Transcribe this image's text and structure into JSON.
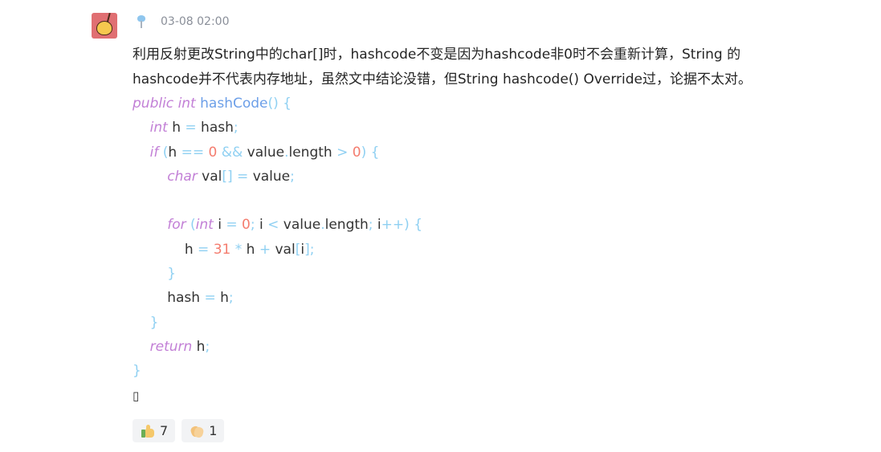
{
  "comment": {
    "timestamp": "03-08 02:00",
    "text_lines": [
      "利用反射更改String中的char[]时，hashcode不变是因为hashcode非0时不会重新计算，String 的",
      "hashcode并不代表内存地址，虽然文中结论没错，但String hashcode() Override过，论据不太对。"
    ],
    "code": [
      [
        [
          "kw",
          "public"
        ],
        [
          "p",
          " "
        ],
        [
          "kw",
          "int"
        ],
        [
          "p",
          " "
        ],
        [
          "fn",
          "hashCode"
        ],
        [
          "pn",
          "()"
        ],
        [
          "p",
          " "
        ],
        [
          "pn",
          "{"
        ]
      ],
      [
        [
          "p",
          "    "
        ],
        [
          "kw",
          "int"
        ],
        [
          "p",
          " h "
        ],
        [
          "op",
          "="
        ],
        [
          "p",
          " hash"
        ],
        [
          "pn",
          ";"
        ]
      ],
      [
        [
          "p",
          "    "
        ],
        [
          "kw",
          "if"
        ],
        [
          "p",
          " "
        ],
        [
          "pn",
          "("
        ],
        [
          "p",
          "h "
        ],
        [
          "op",
          "=="
        ],
        [
          "p",
          " "
        ],
        [
          "nm",
          "0"
        ],
        [
          "p",
          " "
        ],
        [
          "op",
          "&&"
        ],
        [
          "p",
          " value"
        ],
        [
          "pn",
          "."
        ],
        [
          "p",
          "length "
        ],
        [
          "op",
          ">"
        ],
        [
          "p",
          " "
        ],
        [
          "nm",
          "0"
        ],
        [
          "pn",
          ")"
        ],
        [
          "p",
          " "
        ],
        [
          "pn",
          "{"
        ]
      ],
      [
        [
          "p",
          "        "
        ],
        [
          "kw",
          "char"
        ],
        [
          "p",
          " val"
        ],
        [
          "pn",
          "[]"
        ],
        [
          "p",
          " "
        ],
        [
          "op",
          "="
        ],
        [
          "p",
          " value"
        ],
        [
          "pn",
          ";"
        ]
      ],
      [],
      [
        [
          "p",
          "        "
        ],
        [
          "kw",
          "for"
        ],
        [
          "p",
          " "
        ],
        [
          "pn",
          "("
        ],
        [
          "kw",
          "int"
        ],
        [
          "p",
          " i "
        ],
        [
          "op",
          "="
        ],
        [
          "p",
          " "
        ],
        [
          "nm",
          "0"
        ],
        [
          "pn",
          ";"
        ],
        [
          "p",
          " i "
        ],
        [
          "op",
          "<"
        ],
        [
          "p",
          " value"
        ],
        [
          "pn",
          "."
        ],
        [
          "p",
          "length"
        ],
        [
          "pn",
          ";"
        ],
        [
          "p",
          " i"
        ],
        [
          "op",
          "++"
        ],
        [
          "pn",
          ")"
        ],
        [
          "p",
          " "
        ],
        [
          "pn",
          "{"
        ]
      ],
      [
        [
          "p",
          "            h "
        ],
        [
          "op",
          "="
        ],
        [
          "p",
          " "
        ],
        [
          "nm",
          "31"
        ],
        [
          "p",
          " "
        ],
        [
          "op",
          "*"
        ],
        [
          "p",
          " h "
        ],
        [
          "op",
          "+"
        ],
        [
          "p",
          " val"
        ],
        [
          "pn",
          "["
        ],
        [
          "p",
          "i"
        ],
        [
          "pn",
          "]"
        ],
        [
          "pn",
          ";"
        ]
      ],
      [
        [
          "p",
          "        "
        ],
        [
          "pn",
          "}"
        ]
      ],
      [
        [
          "p",
          "        hash "
        ],
        [
          "op",
          "="
        ],
        [
          "p",
          " h"
        ],
        [
          "pn",
          ";"
        ]
      ],
      [
        [
          "p",
          "    "
        ],
        [
          "pn",
          "}"
        ]
      ],
      [
        [
          "p",
          "    "
        ],
        [
          "kw",
          "return"
        ],
        [
          "p",
          " h"
        ],
        [
          "pn",
          ";"
        ]
      ],
      [
        [
          "pn",
          "}"
        ]
      ]
    ],
    "trailing_glyph": "▯"
  },
  "reactions": [
    {
      "icon": "thumbs-up-icon",
      "count": "7"
    },
    {
      "icon": "clapping-hands-icon",
      "count": "1"
    }
  ],
  "colors": {
    "keyword": "#c27fd6",
    "function": "#6c9fe8",
    "punctuation": "#8fd0f2",
    "number": "#f47c6e",
    "text": "#333333",
    "timestamp": "#8a8f99",
    "avatar_bg": "#e06f72"
  }
}
